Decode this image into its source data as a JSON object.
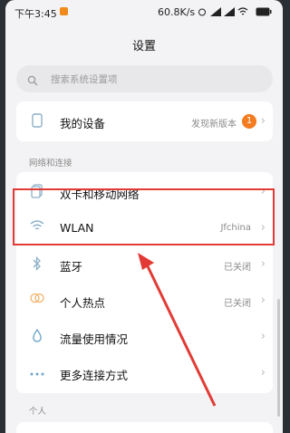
{
  "status_bar": {
    "time": "下午3:45",
    "net_speed": "60.8K/s"
  },
  "page": {
    "title": "设置",
    "search_placeholder": "搜索系统设置项"
  },
  "device": {
    "label": "我的设备",
    "value": "发现新版本",
    "badge": "1"
  },
  "network_section": {
    "header": "网络和连接",
    "items": [
      {
        "label": "双卡和移动网络",
        "value": "",
        "icon": "sim-icon"
      },
      {
        "label": "WLAN",
        "value": "Jfchina",
        "icon": "wifi-icon"
      },
      {
        "label": "蓝牙",
        "value": "已关闭",
        "icon": "bluetooth-icon"
      },
      {
        "label": "个人热点",
        "value": "已关闭",
        "icon": "hotspot-icon"
      },
      {
        "label": "流量使用情况",
        "value": "",
        "icon": "data-usage-icon"
      },
      {
        "label": "更多连接方式",
        "value": "",
        "icon": "more-connections-icon"
      }
    ]
  },
  "personal_section": {
    "header": "个人"
  },
  "colors": {
    "highlight": "#e23b35",
    "badge": "#f47b20",
    "icon_tint": "#8db0c8"
  }
}
